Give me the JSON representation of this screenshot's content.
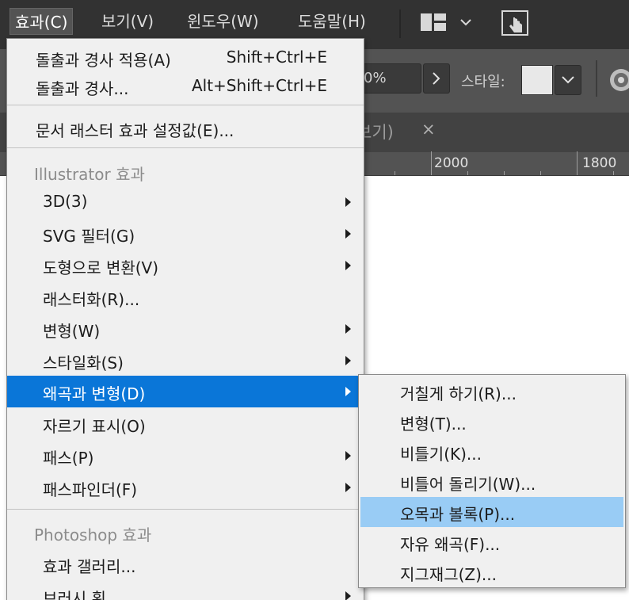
{
  "menubar": {
    "items": [
      "효과(C)",
      "보기(V)",
      "윈도우(W)",
      "도움말(H)"
    ]
  },
  "controlbar": {
    "opacity_value": "0%",
    "style_label": "스타일:"
  },
  "tabbar": {
    "tab_fragment": "보기)",
    "close_glyph": "×"
  },
  "ruler": {
    "labels": [
      "2000",
      "1800"
    ]
  },
  "menu": {
    "apply_last": {
      "label": "돌출과 경사 적용(A)",
      "shortcut": "Shift+Ctrl+E"
    },
    "last_effect": {
      "label": "돌출과 경사...",
      "shortcut": "Alt+Shift+Ctrl+E"
    },
    "raster_settings": {
      "label": "문서 래스터 효과 설정값(E)..."
    },
    "illustrator_header": "Illustrator 효과",
    "illustrator_items": [
      {
        "label": "3D(3)",
        "submenu": true
      },
      {
        "label": "SVG 필터(G)",
        "submenu": true
      },
      {
        "label": "도형으로 변환(V)",
        "submenu": true
      },
      {
        "label": "래스터화(R)...",
        "submenu": false
      },
      {
        "label": "변형(W)",
        "submenu": true
      },
      {
        "label": "스타일화(S)",
        "submenu": true
      },
      {
        "label": "왜곡과 변형(D)",
        "submenu": true,
        "highlighted": true
      },
      {
        "label": "자르기 표시(O)",
        "submenu": false
      },
      {
        "label": "패스(P)",
        "submenu": true
      },
      {
        "label": "패스파인더(F)",
        "submenu": true
      }
    ],
    "photoshop_header": "Photoshop 효과",
    "photoshop_items": [
      {
        "label": "효과 갤러리...",
        "submenu": false
      },
      {
        "label": "브러시 획",
        "submenu": true
      }
    ]
  },
  "submenu": {
    "items": [
      {
        "label": "거칠게 하기(R)..."
      },
      {
        "label": "변형(T)..."
      },
      {
        "label": "비틀기(K)..."
      },
      {
        "label": "비틀어 돌리기(W)..."
      },
      {
        "label": "오목과 볼록(P)...",
        "highlighted": true
      },
      {
        "label": "자유 왜곡(F)..."
      },
      {
        "label": "지그재그(Z)..."
      }
    ]
  },
  "colors": {
    "highlight": "#0a76d8",
    "submenu_highlight": "#99ccf5",
    "menu_bg": "#f0f0f0",
    "app_dark": "#323232"
  },
  "icons": [
    "workspace-layout-icon",
    "chevron-down-icon",
    "hand-touch-icon",
    "opacity-arrow-icon",
    "recolor-wheel-icon"
  ]
}
